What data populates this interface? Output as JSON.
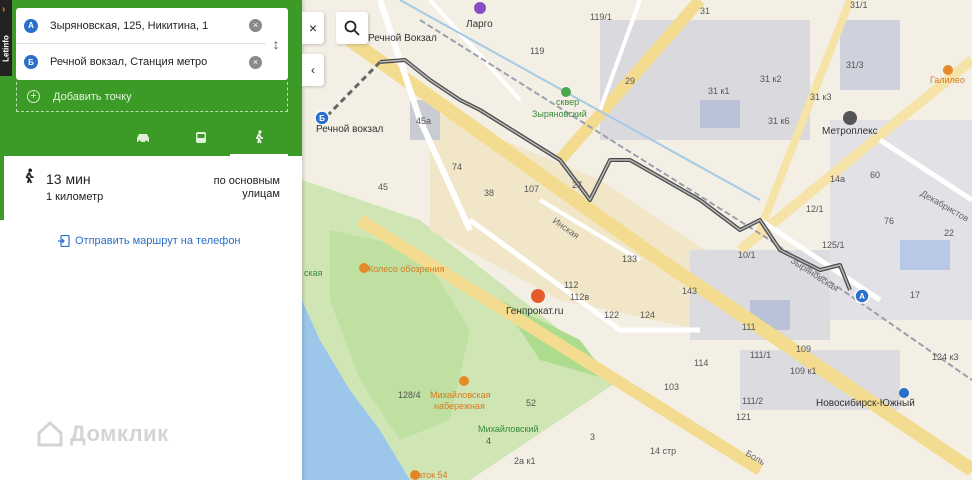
{
  "panel": {
    "brand": "Letinfo",
    "point_a": {
      "badge": "А",
      "text": "Зыряновская, 125, Никитина, 1"
    },
    "point_b": {
      "badge": "Б",
      "text": "Речной вокзал, Станция метро"
    },
    "add_point_label": "Добавить точку",
    "modes": [
      "car",
      "bus",
      "walk"
    ],
    "active_mode": "walk",
    "result": {
      "time": "13 мин",
      "distance": "1 километр",
      "via": "по основным улицам"
    },
    "send_link": "Отправить маршрут на телефон"
  },
  "controls": {
    "close": "×",
    "collapse": "‹"
  },
  "watermark": "Домклик",
  "colors": {
    "panel_green": "#3c9a26",
    "link_blue": "#2a6fc9",
    "route": "#555555"
  },
  "map": {
    "labels": {
      "rechnoy": "Речной Вокзал",
      "rechnoy2": "Речной вокзал",
      "largo": "Ларго",
      "skver1": "сквер",
      "skver2": "Зыряновский",
      "metroplex": "Метроплекс",
      "galileo": "Галилео",
      "dekabristov": "Декабристов",
      "zyrianovskaya": "Зыряновская",
      "inskaya": "Инская",
      "koleso": "Колесо обозрения",
      "genprokat": "Генпрокат.ru",
      "mikh_nab1": "Михайловская",
      "mikh_nab2": "набережная",
      "mikhailovskiy": "Михайловский",
      "novosib": "Новосибирск-Южный",
      "katok": "Каток 54",
      "bolsh": "Боль",
      "sk": "ская"
    },
    "house_numbers": [
      "119/1",
      "119",
      "29",
      "31",
      "31/1",
      "31 к1",
      "31 к2",
      "31 к6",
      "31/3",
      "31 к3",
      "45а",
      "74",
      "38",
      "107",
      "27",
      "133",
      "112",
      "112в",
      "122",
      "124",
      "143",
      "14а",
      "12/1",
      "60",
      "76",
      "10/1",
      "125/1",
      "111",
      "111/1",
      "111/2",
      "109",
      "109 к1",
      "124 к3",
      "103",
      "114",
      "121",
      "128/4",
      "52",
      "4",
      "14 стр",
      "3",
      "2а к1",
      "45",
      "22",
      "17"
    ]
  }
}
